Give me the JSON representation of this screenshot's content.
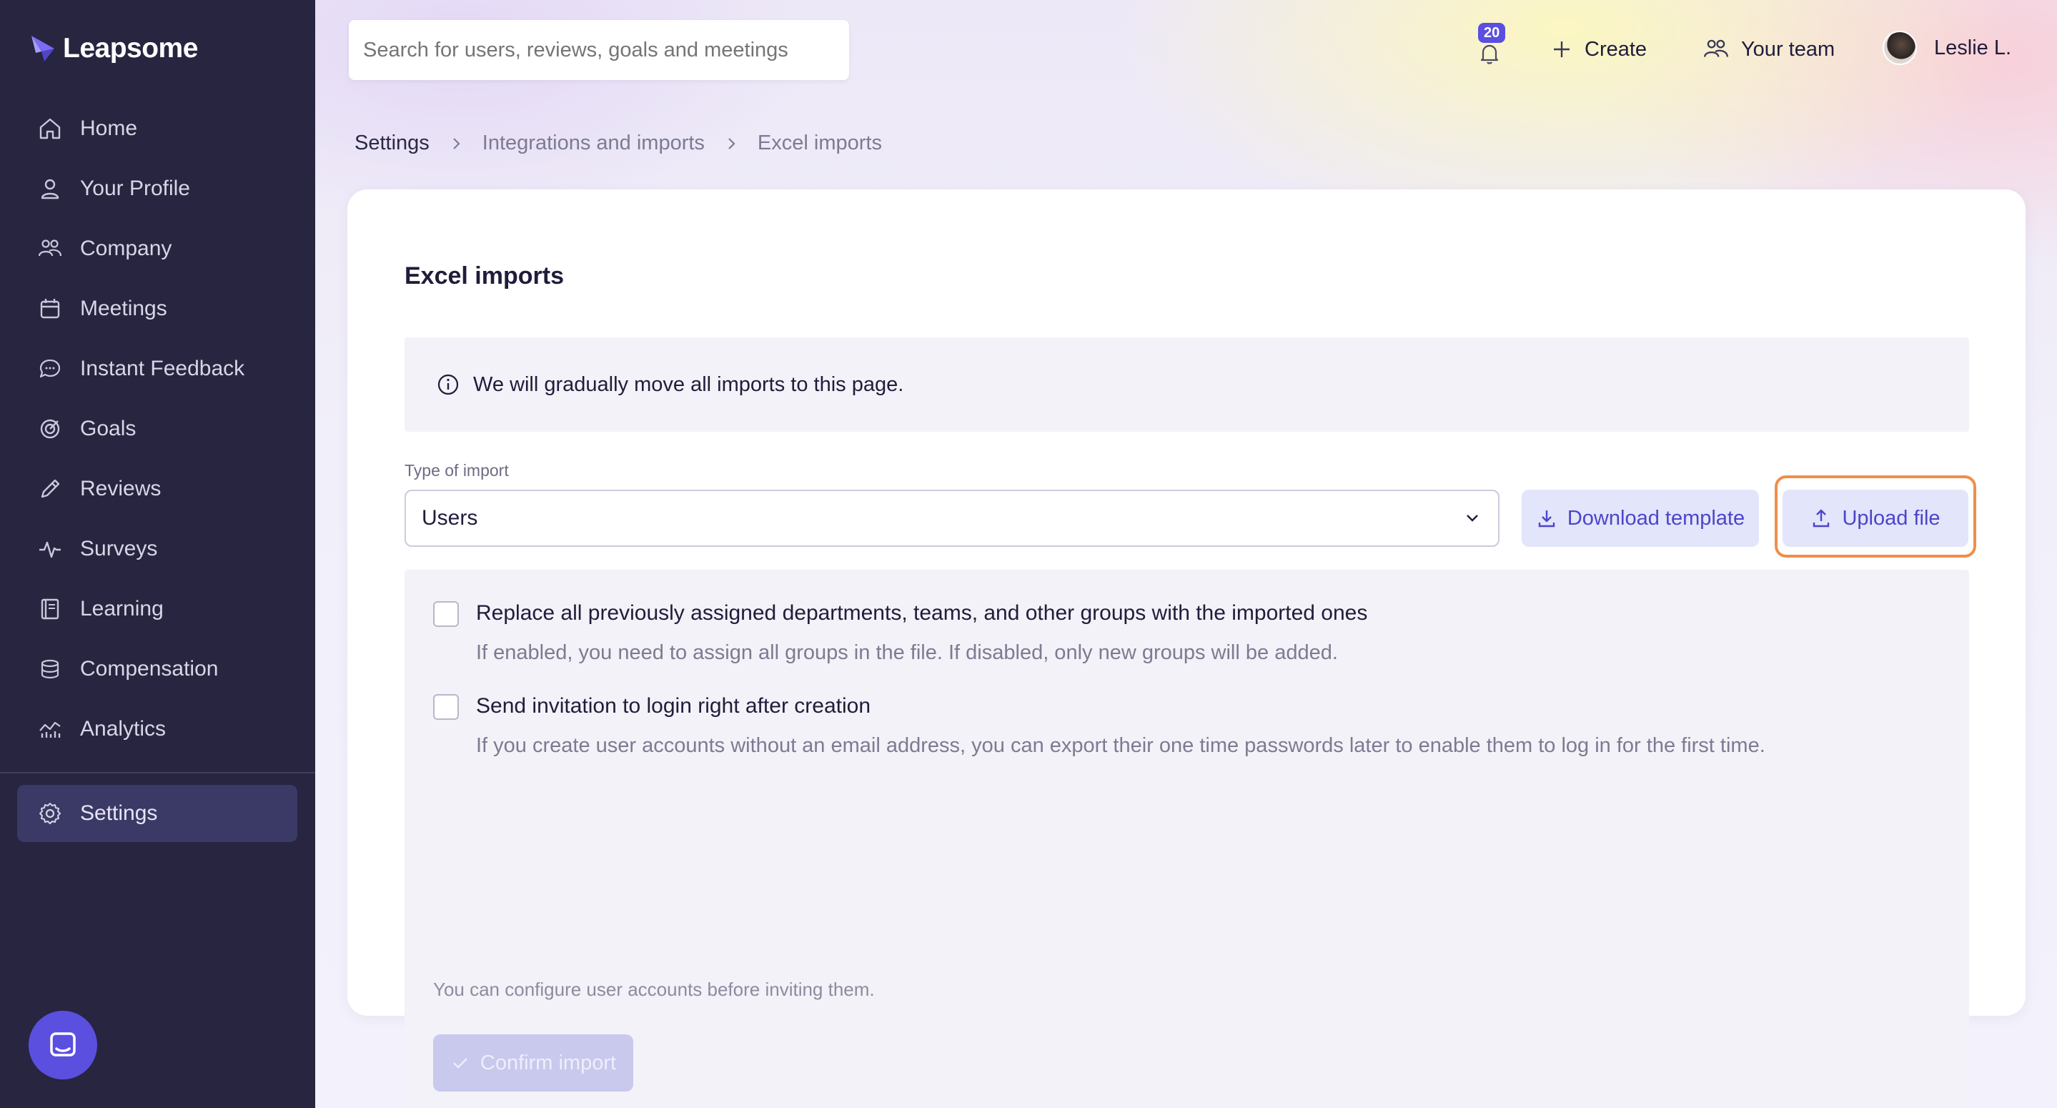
{
  "app": {
    "name": "Leapsome",
    "brand_color": "#5b4fe0",
    "sidebar_bg": "#272540",
    "highlight_color": "#ef8e4b"
  },
  "sidebar": {
    "items": [
      {
        "label": "Home",
        "icon": "home-icon"
      },
      {
        "label": "Your Profile",
        "icon": "user-icon"
      },
      {
        "label": "Company",
        "icon": "people-icon"
      },
      {
        "label": "Meetings",
        "icon": "calendar-icon"
      },
      {
        "label": "Instant Feedback",
        "icon": "chat-icon"
      },
      {
        "label": "Goals",
        "icon": "target-icon"
      },
      {
        "label": "Reviews",
        "icon": "pencil-icon"
      },
      {
        "label": "Surveys",
        "icon": "pulse-icon"
      },
      {
        "label": "Learning",
        "icon": "book-icon"
      },
      {
        "label": "Compensation",
        "icon": "coins-icon"
      },
      {
        "label": "Analytics",
        "icon": "chart-icon"
      }
    ],
    "settings": {
      "label": "Settings",
      "icon": "gear-icon"
    }
  },
  "header": {
    "search_placeholder": "Search for users, reviews, goals and meetings",
    "notifications_count": "20",
    "create_label": "Create",
    "team_label": "Your team",
    "user_name": "Leslie L."
  },
  "breadcrumb": [
    "Settings",
    "Integrations and imports",
    "Excel imports"
  ],
  "page": {
    "title": "Excel imports",
    "info_text": "We will gradually move all imports to this page.",
    "type_label": "Type of import",
    "type_value": "Users",
    "download_label": "Download template",
    "upload_label": "Upload file",
    "options": [
      {
        "title": "Replace all previously assigned departments, teams, and other groups with the imported ones",
        "description": "If enabled, you need to assign all groups in the file. If disabled, only new groups will be added.",
        "checked": false
      },
      {
        "title": "Send invitation to login right after creation",
        "description": "If you create user accounts without an email address, you can export their one time passwords later to enable them to log in for the first time.",
        "checked": false
      }
    ],
    "note": "You can configure user accounts before inviting them.",
    "confirm_label": "Confirm import"
  }
}
